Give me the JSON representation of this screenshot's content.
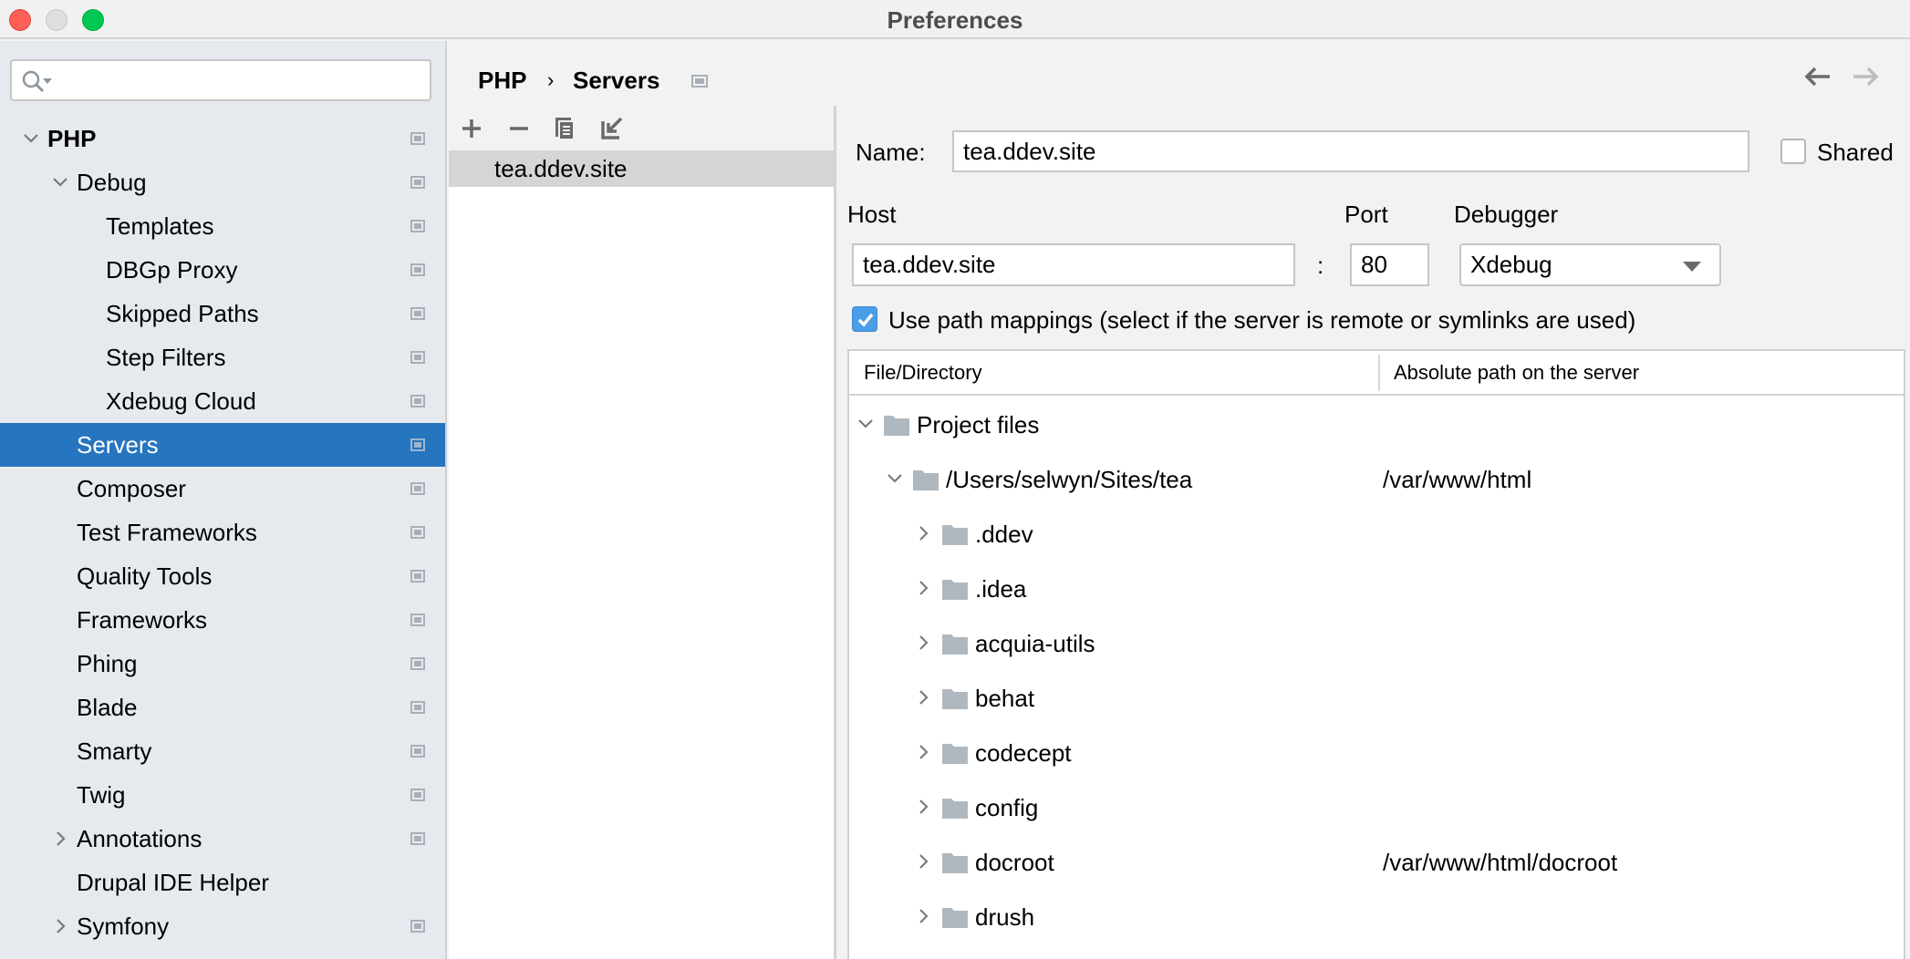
{
  "window": {
    "title": "Preferences",
    "controls": [
      "close",
      "minimize",
      "maximize"
    ]
  },
  "search": {
    "placeholder": "",
    "value": ""
  },
  "sidebar": {
    "items": [
      {
        "label": "PHP",
        "level": 0,
        "expanded": true,
        "bold": true,
        "project_icon": true
      },
      {
        "label": "Debug",
        "level": 1,
        "expanded": true,
        "project_icon": true
      },
      {
        "label": "Templates",
        "level": 2,
        "project_icon": true
      },
      {
        "label": "DBGp Proxy",
        "level": 2,
        "project_icon": true
      },
      {
        "label": "Skipped Paths",
        "level": 2,
        "project_icon": true
      },
      {
        "label": "Step Filters",
        "level": 2,
        "project_icon": true
      },
      {
        "label": "Xdebug Cloud",
        "level": 2,
        "project_icon": true
      },
      {
        "label": "Servers",
        "level": 1,
        "selected": true,
        "project_icon": true
      },
      {
        "label": "Composer",
        "level": 1,
        "project_icon": true
      },
      {
        "label": "Test Frameworks",
        "level": 1,
        "project_icon": true
      },
      {
        "label": "Quality Tools",
        "level": 1,
        "project_icon": true
      },
      {
        "label": "Frameworks",
        "level": 1,
        "project_icon": true
      },
      {
        "label": "Phing",
        "level": 1,
        "project_icon": true
      },
      {
        "label": "Blade",
        "level": 1,
        "project_icon": true
      },
      {
        "label": "Smarty",
        "level": 1,
        "project_icon": true
      },
      {
        "label": "Twig",
        "level": 1,
        "project_icon": true
      },
      {
        "label": "Annotations",
        "level": 1,
        "expanded": false,
        "project_icon": true
      },
      {
        "label": "Drupal IDE Helper",
        "level": 1,
        "project_icon": false
      },
      {
        "label": "Symfony",
        "level": 1,
        "expanded": false,
        "project_icon": true
      }
    ]
  },
  "breadcrumb": {
    "parent": "PHP",
    "separator": "›",
    "current": "Servers"
  },
  "nav": {
    "back_icon": "arrow-left-icon",
    "forward_icon": "arrow-right-icon",
    "forward_enabled": false
  },
  "servers_toolbar": {
    "buttons": [
      {
        "icon": "add-icon",
        "tooltip": "Add"
      },
      {
        "icon": "remove-icon",
        "tooltip": "Remove"
      },
      {
        "icon": "copy-icon",
        "tooltip": "Copy"
      },
      {
        "icon": "import-icon",
        "tooltip": "Import"
      }
    ]
  },
  "servers": {
    "list": [
      "tea.ddev.site"
    ],
    "selected": "tea.ddev.site"
  },
  "form": {
    "name_label": "Name:",
    "name_value": "tea.ddev.site",
    "shared_label": "Shared",
    "shared_checked": false,
    "host_label": "Host",
    "host_value": "tea.ddev.site",
    "colon": ":",
    "port_label": "Port",
    "port_value": "80",
    "debugger_label": "Debugger",
    "debugger_value": "Xdebug",
    "path_mappings_label": "Use path mappings (select if the server is remote or symlinks are used)",
    "path_mappings_checked": true
  },
  "mappings_table": {
    "columns": [
      "File/Directory",
      "Absolute path on the server"
    ],
    "rows": [
      {
        "name": "Project files",
        "level": 0,
        "expanded": true,
        "server_path": ""
      },
      {
        "name": "/Users/selwyn/Sites/tea",
        "level": 1,
        "expanded": true,
        "server_path": "/var/www/html"
      },
      {
        "name": ".ddev",
        "level": 2,
        "expanded": false,
        "server_path": ""
      },
      {
        "name": ".idea",
        "level": 2,
        "expanded": false,
        "server_path": ""
      },
      {
        "name": "acquia-utils",
        "level": 2,
        "expanded": false,
        "server_path": ""
      },
      {
        "name": "behat",
        "level": 2,
        "expanded": false,
        "server_path": ""
      },
      {
        "name": "codecept",
        "level": 2,
        "expanded": false,
        "server_path": ""
      },
      {
        "name": "config",
        "level": 2,
        "expanded": false,
        "server_path": ""
      },
      {
        "name": "docroot",
        "level": 2,
        "expanded": false,
        "server_path": "/var/www/html/docroot"
      },
      {
        "name": "drush",
        "level": 2,
        "expanded": false,
        "server_path": ""
      }
    ]
  },
  "colors": {
    "selection": "#2675bf",
    "sidebar_bg": "#e6eaee",
    "checkbox_accent": "#4a9ee6",
    "folder": "#afb8bf"
  }
}
